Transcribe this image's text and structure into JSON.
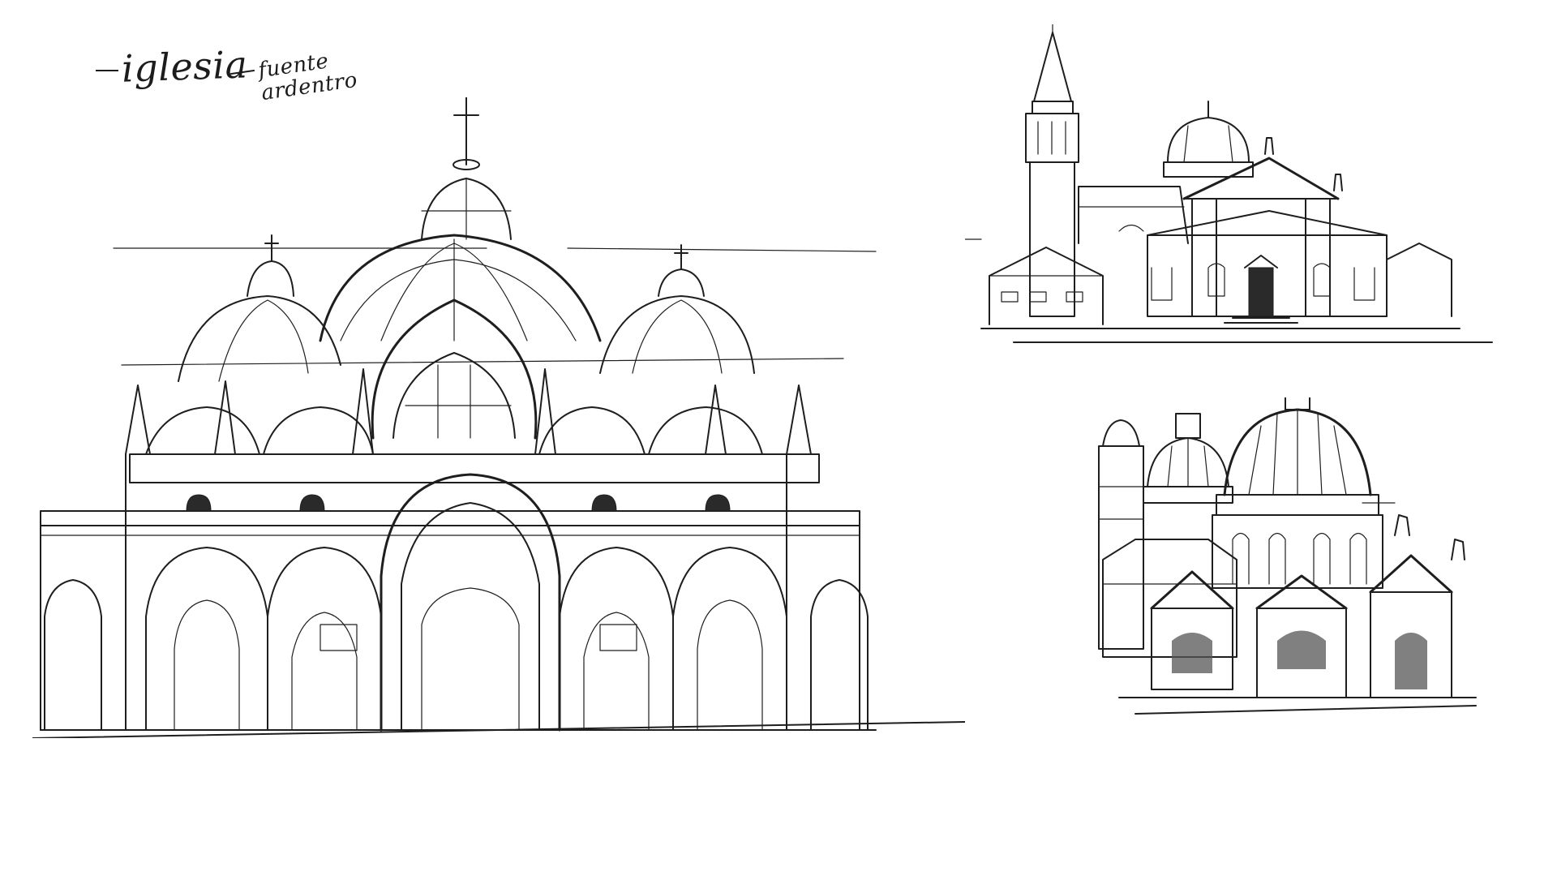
{
  "notes": {
    "main": "iglesia",
    "side_line1": "fuente",
    "side_line2": "ardentro"
  },
  "sketches": [
    {
      "icon": "st-marks-basilica-sketch"
    },
    {
      "icon": "church-with-bell-tower-sketch"
    },
    {
      "icon": "domed-church-sketch"
    }
  ],
  "colors": {
    "ink": "#1e1e1e",
    "paper": "#ffffff"
  }
}
